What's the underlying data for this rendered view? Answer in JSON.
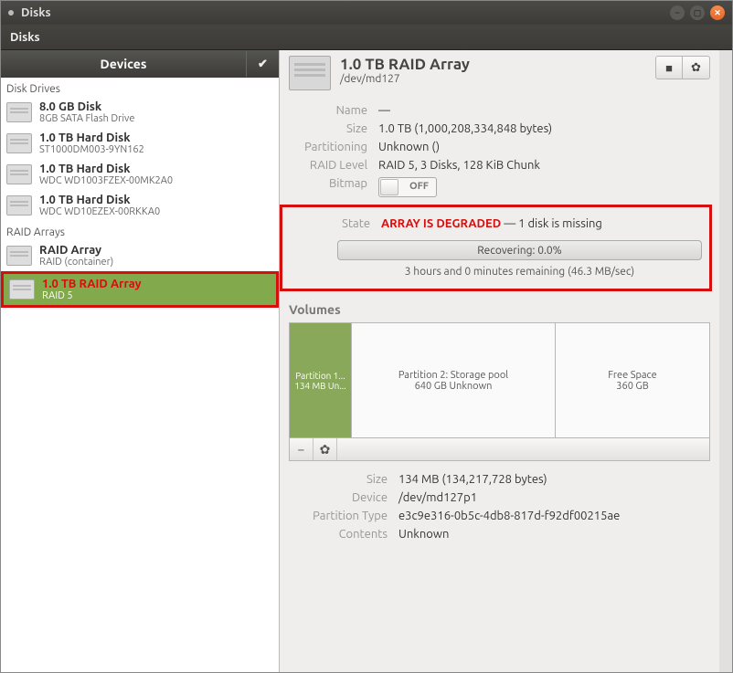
{
  "window": {
    "app_title": "Disks"
  },
  "subheader": {
    "title": "Disks"
  },
  "left": {
    "header_label": "Devices",
    "section_drives": "Disk Drives",
    "section_raid": "RAID Arrays",
    "drives": [
      {
        "title": "8.0 GB Disk",
        "subtitle": "8GB SATA Flash Drive"
      },
      {
        "title": "1.0 TB Hard Disk",
        "subtitle": "ST1000DM003-9YN162"
      },
      {
        "title": "1.0 TB Hard Disk",
        "subtitle": "WDC WD1003FZEX-00MK2A0"
      },
      {
        "title": "1.0 TB Hard Disk",
        "subtitle": "WDC WD10EZEX-00RKKA0"
      }
    ],
    "arrays": [
      {
        "title": "RAID Array",
        "subtitle": "RAID (container)"
      },
      {
        "title": "1.0 TB RAID Array",
        "subtitle": "RAID 5"
      }
    ]
  },
  "header_info": {
    "title": "1.0 TB RAID Array",
    "path": "/dev/md127"
  },
  "info": {
    "name_label": "Name",
    "name_value": "—",
    "size_label": "Size",
    "size_value": "1.0 TB (1,000,208,334,848 bytes)",
    "part_label": "Partitioning",
    "part_value": "Unknown ()",
    "raid_label": "RAID Level",
    "raid_value": "RAID 5, 3 Disks, 128 KiB Chunk",
    "bitmap_label": "Bitmap",
    "bitmap_value": "OFF",
    "state_label": "State",
    "state_degraded": "ARRAY IS DEGRADED",
    "state_rest": " — 1 disk is missing",
    "recovering": "Recovering: 0.0%",
    "remaining": "3 hours and 0 minutes remaining (46.3 MB/sec)"
  },
  "volumes_header": "Volumes",
  "chart_data": {
    "type": "bar",
    "title": "Volumes layout",
    "blocks": [
      {
        "label": "Partition 1...",
        "sub": "134 MB Un..."
      },
      {
        "label": "Partition 2: Storage pool",
        "sub": "640 GB Unknown"
      },
      {
        "label": "Free Space",
        "sub": "360 GB"
      }
    ]
  },
  "vol_details": {
    "size_label": "Size",
    "size_value": "134 MB (134,217,728 bytes)",
    "device_label": "Device",
    "device_value": "/dev/md127p1",
    "ptype_label": "Partition Type",
    "ptype_value": "e3c9e316-0b5c-4db8-817d-f92df00215ae",
    "contents_label": "Contents",
    "contents_value": "Unknown"
  }
}
